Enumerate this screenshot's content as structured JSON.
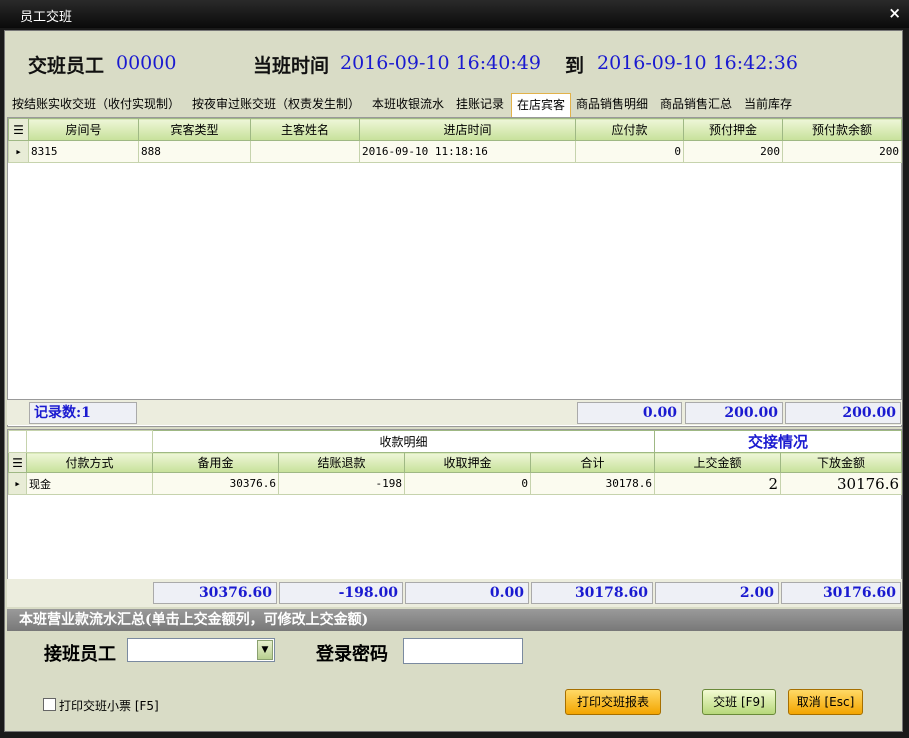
{
  "window": {
    "title": "员工交班",
    "close_glyph": "×"
  },
  "header": {
    "employee_label": "交班员工",
    "employee_value": "00000",
    "time_label": "当班时间",
    "start_time": "2016-09-10 16:40:49",
    "to_label": "到",
    "end_time": "2016-09-10 16:42:36"
  },
  "tabs": [
    {
      "label": "按结账实收交班（收付实现制）"
    },
    {
      "label": "按夜审过账交班（权责发生制）"
    },
    {
      "label": "本班收银流水"
    },
    {
      "label": "挂账记录"
    },
    {
      "label": "在店宾客",
      "active": true
    },
    {
      "label": "商品销售明细"
    },
    {
      "label": "商品销售汇总"
    },
    {
      "label": "当前库存"
    }
  ],
  "guests": {
    "columns": [
      "房间号",
      "宾客类型",
      "主客姓名",
      "进店时间",
      "应付款",
      "预付押金",
      "预付款余额"
    ],
    "rows": [
      [
        "8315",
        "888",
        "",
        "2016-09-10 11:18:16",
        "0",
        "200",
        "200"
      ]
    ],
    "record_count": "记录数:1",
    "totals": [
      "0.00",
      "200.00",
      "200.00"
    ]
  },
  "payments": {
    "group_receive": "收款明细",
    "group_handover": "交接情况",
    "columns": [
      "付款方式",
      "备用金",
      "结账退款",
      "收取押金",
      "合计",
      "上交金额",
      "下放金额"
    ],
    "rows": [
      [
        "现金",
        "30376.6",
        "-198",
        "0",
        "30178.6",
        "2",
        "30176.6"
      ]
    ],
    "totals": [
      "30376.60",
      "-198.00",
      "0.00",
      "30178.60",
      "2.00",
      "30176.60"
    ]
  },
  "summary_bar": "本班营业款流水汇总(单击上交金额列，可修改上交金额)",
  "form": {
    "receiver_label": "接班员工",
    "receiver_value": "",
    "password_label": "登录密码",
    "password_value": ""
  },
  "print_ticket": {
    "label": "打印交班小票 [F5]",
    "checked": false
  },
  "buttons": {
    "print_report": "打印交班报表",
    "handover": "交班 [F9]",
    "cancel": "取消 [Esc]"
  },
  "colors": {
    "accent_text": "#1a1ad0",
    "tab_active_border": "#e2b24a",
    "button_orange": "#f3a500",
    "button_green": "#b7d87a"
  }
}
